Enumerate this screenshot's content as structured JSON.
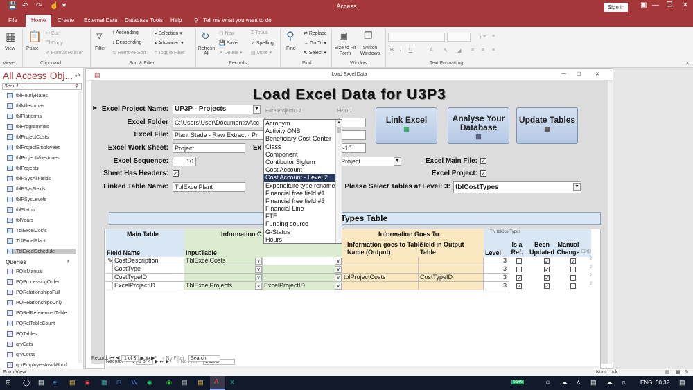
{
  "app": {
    "title": "Access",
    "signin": "Sign in"
  },
  "tabs": [
    "File",
    "Home",
    "Create",
    "External Data",
    "Database Tools",
    "Help"
  ],
  "tell_me": "Tell me what you want to do",
  "ribbon": {
    "views": {
      "view": "View",
      "group": "Views"
    },
    "clipboard": {
      "paste": "Paste",
      "cut": "Cut",
      "copy": "Copy",
      "format_painter": "Format Painter",
      "group": "Clipboard"
    },
    "sort_filter": {
      "filter": "Filter",
      "ascending": "Ascending",
      "descending": "Descending",
      "remove_sort": "Remove Sort",
      "selection": "Selection",
      "advanced": "Advanced",
      "toggle_filter": "Toggle Filter",
      "group": "Sort & Filter"
    },
    "records": {
      "refresh": "Refresh All",
      "new": "New",
      "save": "Save",
      "delete": "Delete",
      "totals": "Totals",
      "spelling": "Spelling",
      "more": "More",
      "group": "Records"
    },
    "find": {
      "find": "Find",
      "replace": "Replace",
      "goto": "Go To",
      "select": "Select",
      "group": "Find"
    },
    "window": {
      "size_to_fit": "Size to Fit Form",
      "switch": "Switch Windows",
      "group": "Window"
    },
    "text_formatting": {
      "group": "Text Formatting"
    }
  },
  "nav": {
    "title": "All Access Obj...",
    "search_placeholder": "Search...",
    "tables": [
      "tblHourlyRates",
      "tblMilestones",
      "tblPlatforms",
      "tblProgrammes",
      "tblProjectCosts",
      "tblProjectEmployees",
      "tblProjectMilestones",
      "tblProjects",
      "tblPSysAllFields",
      "tblPSysFields",
      "tblPSysLevels",
      "tblStatus",
      "tblYears",
      "TblExcelCosts",
      "TblExcelPlant",
      "TblExcelSchedule"
    ],
    "queries_header": "Queries",
    "queries": [
      "PQIsManual",
      "PQProcessingOrder",
      "PQRelationshipsFull",
      "PQRelationshipsOnly",
      "PQRelReferencedTable...",
      "PQRelTableCount",
      "PQTables",
      "qryCats",
      "qryCosts",
      "qryEmployeeAvailWorkl"
    ]
  },
  "form": {
    "window_title": "Load Excel Data",
    "title": "Load Excel Data for U3P3",
    "labels": {
      "project_name": "Excel Project Name:",
      "folder": "Excel Folder",
      "file": "Excel File:",
      "work_sheet": "Excel Work Sheet:",
      "sequence": "Excel Sequence:",
      "has_headers": "Sheet Has Headers:",
      "linked_table": "Linked Table Name:",
      "main_file": "Excel Main File:",
      "excel_project": "Excel Project:",
      "select_tables": "Please Select Tables at Level: 3:",
      "ws_cut": "Ex",
      "excel_project_id": "ExcelProjectID",
      "epid": "EPID"
    },
    "values": {
      "project_name": "UP3P - Projects",
      "folder": "C:\\Users\\User\\Documents\\Acc",
      "file": "Plant Stade - Raw Extract - Pr",
      "work_sheet": "Project",
      "sequence": "10",
      "linked_table": "TblExcelPlant",
      "project_combo": "Project",
      "date_cut": "t-18",
      "select_tables": "tblCostTypes",
      "excel_project_id": "2",
      "epid": "1"
    },
    "buttons": {
      "link_excel": "Link Excel",
      "analyse": "Analyse Your Database",
      "update": "Update Tables"
    },
    "banner": "CostTypes Table",
    "grid": {
      "main_table": "Main Table",
      "information": "Information C",
      "info_goes_to": "Information Goes To:",
      "field_name": "Field Name",
      "input_table": "InputTable",
      "info_goes_to_table": "Information goes to Table Name (Output)",
      "field_in_output": "Field in Output Table",
      "level": "Level",
      "is_ref": "Is a Ref.",
      "been_updated": "Been Updated",
      "manual_change": "Manual Change",
      "epid": "EPID",
      "tn": "TN",
      "tn_value": "tblCostTypes",
      "rows": [
        {
          "field": "CostDescription",
          "input": "TblExcelCosts",
          "info": "",
          "out_table": "",
          "out_field": "",
          "level": "3",
          "ref": false,
          "updated": true,
          "manual": true,
          "epid": "2"
        },
        {
          "field": "CostType",
          "input": "",
          "info": "",
          "out_table": "",
          "out_field": "",
          "level": "3",
          "ref": false,
          "updated": true,
          "manual": false,
          "epid": "2"
        },
        {
          "field": "CostTypeID",
          "input": "",
          "info": "",
          "out_table": "tblProjectCosts",
          "out_field": "CostTypeID",
          "level": "3",
          "ref": true,
          "updated": true,
          "manual": false,
          "epid": "2"
        },
        {
          "field": "ExcelProjectID",
          "input": "TblExcelProjects",
          "info": "ExcelProjectID",
          "out_table": "",
          "out_field": "",
          "level": "3",
          "ref": true,
          "updated": true,
          "manual": false,
          "epid": "2"
        }
      ]
    },
    "dropdown": [
      "Acronym",
      "Activity ONB",
      "Beneficiary Cost Center",
      "Class",
      "Component",
      "Contibutor Siglum",
      "Cost Account",
      "Cost Account - Level 2",
      "Expenditure type rename",
      "Financial free field #1",
      "Financial free field #3",
      "Financial Line",
      "FTE",
      "Funding source",
      "G-Status",
      "Hours"
    ],
    "dropdown_selected": 7,
    "sub_nav": {
      "record": "Record:",
      "pos": "1 of 4",
      "no_filter": "No Filter",
      "search": "Search"
    },
    "main_nav": {
      "record": "Record:",
      "pos": "1 of 3",
      "no_filter": "No Filter",
      "search": "Search"
    }
  },
  "status": {
    "left": "Form View",
    "right": "Num Lock"
  },
  "taskbar": {
    "battery": "56%",
    "lang": "ENG",
    "time": "00:32"
  }
}
